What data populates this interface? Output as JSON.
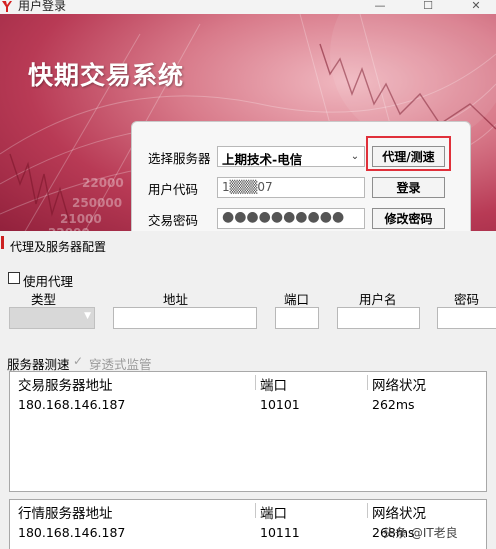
{
  "window": {
    "title": "用户登录",
    "app_title": "快期交易系统",
    "min_glyph": "—",
    "max_glyph": "☐",
    "close_glyph": "✕"
  },
  "banner_numbers": [
    "22000",
    "250000",
    "21000",
    "22000"
  ],
  "login": {
    "server_label": "选择服务器",
    "server_value": "上期技术-电信",
    "user_label": "用户代码",
    "user_value": "1▒▒▒07",
    "password_label": "交易密码",
    "password_dots": "●●●●●●●●●●",
    "proxy_button": "代理/测速",
    "login_button": "登录",
    "change_password_button": "修改密码",
    "highlight_color": "#e0303a"
  },
  "proxy_dialog": {
    "title": "代理及服务器配置",
    "use_proxy_label": "使用代理",
    "columns": {
      "type": "类型",
      "address": "地址",
      "port": "端口",
      "username": "用户名",
      "password": "密码"
    },
    "test_label": "服务器测速",
    "transparent_monitor_label": "穿透式监管",
    "trade_grid": {
      "headers": [
        "交易服务器地址",
        "端口",
        "网络状况"
      ],
      "rows": [
        [
          "180.168.146.187",
          "10101",
          "262ms"
        ]
      ]
    },
    "quote_grid": {
      "headers": [
        "行情服务器地址",
        "端口",
        "网络状况"
      ],
      "rows": [
        [
          "180.168.146.187",
          "10111",
          "268ms"
        ]
      ]
    }
  },
  "watermark": "头条 @IT老良"
}
